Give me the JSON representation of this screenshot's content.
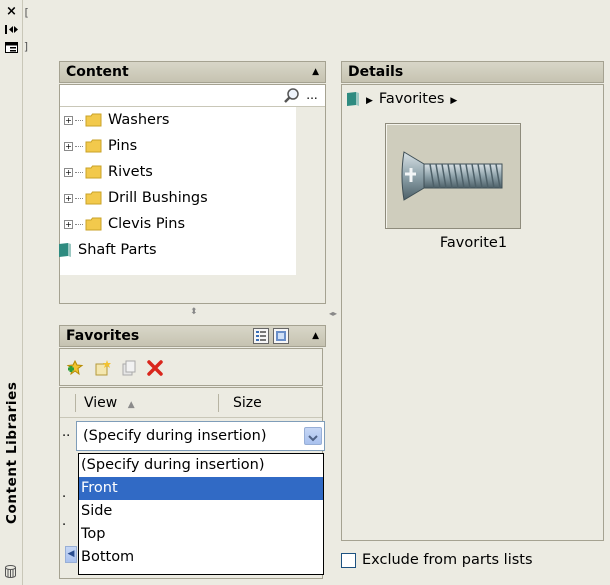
{
  "strip": {
    "close_icon": "×",
    "panel_title": "Content Libraries"
  },
  "content": {
    "title": "Content",
    "search_value": "",
    "more_label": "...",
    "tree": [
      {
        "label": "Washers",
        "type": "folder"
      },
      {
        "label": "Pins",
        "type": "folder"
      },
      {
        "label": "Rivets",
        "type": "folder"
      },
      {
        "label": "Drill Bushings",
        "type": "folder"
      },
      {
        "label": "Clevis Pins",
        "type": "folder"
      },
      {
        "label": "Shaft Parts",
        "type": "book"
      }
    ]
  },
  "favorites": {
    "title": "Favorites",
    "columns": {
      "view": "View",
      "size": "Size"
    },
    "row_marker": "..",
    "combo_value": "(Specify during insertion)",
    "options": [
      {
        "label": "(Specify during insertion)",
        "selected": false
      },
      {
        "label": "Front",
        "selected": true
      },
      {
        "label": "Side",
        "selected": false
      },
      {
        "label": "Top",
        "selected": false
      },
      {
        "label": "Bottom",
        "selected": false
      }
    ]
  },
  "details": {
    "title": "Details",
    "breadcrumb": "Favorites",
    "item_label": "Favorite1",
    "exclude_label": "Exclude from parts lists",
    "exclude_checked": false
  },
  "colors": {
    "panel_bg": "#ecebe2",
    "selection": "#316ac5",
    "delete_red": "#d9261c"
  }
}
